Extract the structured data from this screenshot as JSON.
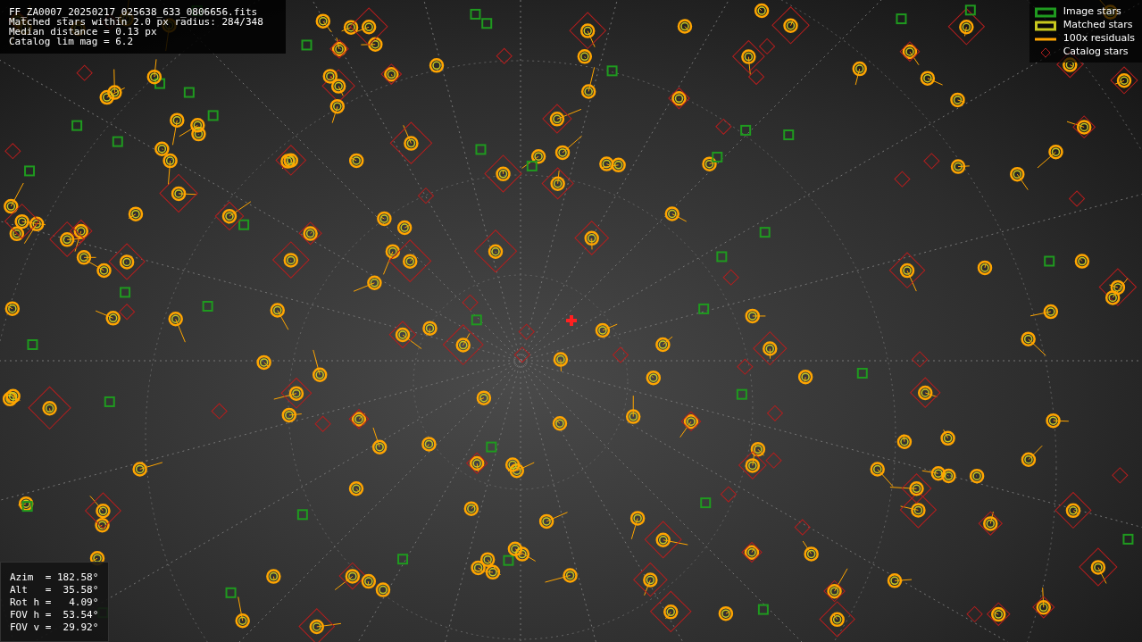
{
  "header_lines": [
    "FF_ZA0007_20250217_025638_633_0806656.fits",
    "Matched stars within 2.0 px radius: 284/348",
    "Median distance = 0.13 px",
    "Catalog lim mag = 6.2"
  ],
  "legend": [
    {
      "kind": "image",
      "label": "Image stars",
      "color": "#1f9a1f"
    },
    {
      "kind": "matched",
      "label": "Matched stars",
      "color": "#c8c81e"
    },
    {
      "kind": "residual",
      "label": "100x residuals",
      "color": "#ffa500"
    },
    {
      "kind": "catalog",
      "label": "Catalog stars",
      "color": "#b41e1e"
    }
  ],
  "pointing_lines": [
    "Azim  = 182.58°",
    "Alt   =  35.58°",
    "Rot h =   4.09°",
    "FOV h =  53.54°",
    "FOV v =  29.92°"
  ]
}
